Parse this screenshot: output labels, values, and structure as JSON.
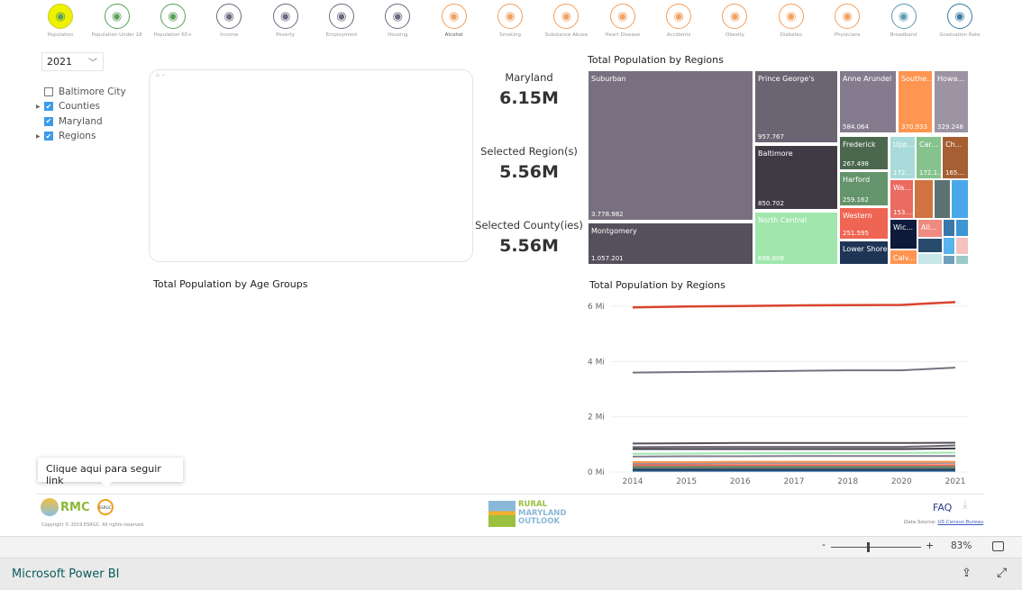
{
  "nav": [
    {
      "label": "Population",
      "icon": "family-icon",
      "color": "#5aa05a",
      "active": true
    },
    {
      "label": "Population Under 18",
      "icon": "children-icon",
      "color": "#5aa05a"
    },
    {
      "label": "Population 65+",
      "icon": "seniors-icon",
      "color": "#5aa05a"
    },
    {
      "label": "Income",
      "icon": "money-hand-icon",
      "color": "#6a6a80"
    },
    {
      "label": "Poverty",
      "icon": "money-bag-icon",
      "color": "#6a6a80"
    },
    {
      "label": "Employment",
      "icon": "briefcase-icon",
      "color": "#6a6a80"
    },
    {
      "label": "Housing",
      "icon": "house-icon",
      "color": "#6a6a80"
    },
    {
      "label": "Alcohol",
      "icon": "beer-icon",
      "color": "#f0a060"
    },
    {
      "label": "Smoking",
      "icon": "cigarette-icon",
      "color": "#f0a060"
    },
    {
      "label": "Substance Abuse",
      "icon": "pills-icon",
      "color": "#f0a060"
    },
    {
      "label": "Heart Disease",
      "icon": "heart-organ-icon",
      "color": "#f0a060"
    },
    {
      "label": "Accidents",
      "icon": "accident-icon",
      "color": "#f0a060"
    },
    {
      "label": "Obesity",
      "icon": "scale-icon",
      "color": "#f0a060"
    },
    {
      "label": "Diabetes",
      "icon": "heartbeat-icon",
      "color": "#f0a060"
    },
    {
      "label": "Physicians",
      "icon": "stethoscope-icon",
      "color": "#f0a060"
    },
    {
      "label": "Broadband",
      "icon": "antenna-icon",
      "color": "#5a9ab0"
    },
    {
      "label": "Graduation Rate",
      "icon": "graduate-icon",
      "color": "#3a7aa0"
    }
  ],
  "active_color": "#eef200",
  "year": "2021",
  "slicer": [
    {
      "label": "Baltimore City",
      "checked": false,
      "expandable": false
    },
    {
      "label": "Counties",
      "checked": true,
      "expandable": true
    },
    {
      "label": "Maryland",
      "checked": true,
      "expandable": false
    },
    {
      "label": "Regions",
      "checked": true,
      "expandable": true
    }
  ],
  "kpis": [
    {
      "label": "Maryland",
      "value": "6.15M"
    },
    {
      "label": "Selected Region(s)",
      "value": "5.56M"
    },
    {
      "label": "Selected County(ies)",
      "value": "5.56M"
    }
  ],
  "age_title": "Total Population by Age Groups",
  "treemap": {
    "title": "Total Population by Regions",
    "cells": [
      {
        "name": "Suburban",
        "value": "3.778.982",
        "color": "#787080"
      },
      {
        "name": "Montgomery",
        "value": "1.057.201",
        "color": "#564f5c"
      },
      {
        "name": "Prince George's",
        "value": "957.767",
        "color": "#6b6472"
      },
      {
        "name": "Baltimore",
        "value": "850.702",
        "color": "#3f3a44"
      },
      {
        "name": "North Central",
        "value": "698.808",
        "color": "#a0e6ad"
      },
      {
        "name": "Anne Arundel",
        "value": "584.064",
        "color": "#847c8e"
      },
      {
        "name": "Southe...",
        "value": "370.933",
        "color": "#fe9550"
      },
      {
        "name": "Howa...",
        "value": "329.248",
        "color": "#9c94a2"
      },
      {
        "name": "Frederick",
        "value": "267.498",
        "color": "#4b684f"
      },
      {
        "name": "Harford",
        "value": "259.162",
        "color": "#64946b"
      },
      {
        "name": "Western",
        "value": "251.595",
        "color": "#ef6553"
      },
      {
        "name": "Lower Shore",
        "value": "",
        "color": "#1f3556"
      },
      {
        "name": "Upp...",
        "value": "172....",
        "color": "#a8dbd9"
      },
      {
        "name": "Car...",
        "value": "172.1...",
        "color": "#86c28e"
      },
      {
        "name": "Ch...",
        "value": "165....",
        "color": "#a65f33"
      },
      {
        "name": "Wa...",
        "value": "153....",
        "color": "#ea6b5f"
      },
      {
        "name": "",
        "value": "",
        "color": "#cf7440"
      },
      {
        "name": "",
        "value": "",
        "color": "#5c7272"
      },
      {
        "name": "",
        "value": "",
        "color": "#4aa8ea"
      },
      {
        "name": "Wic...",
        "value": "",
        "color": "#0f1a3a"
      },
      {
        "name": "Calv...",
        "value": "",
        "color": "#fe9550"
      },
      {
        "name": "All...",
        "value": "",
        "color": "#ef8a80"
      },
      {
        "name": "",
        "value": "",
        "color": "#284b6c"
      },
      {
        "name": "",
        "value": "",
        "color": "#c7e7e8"
      },
      {
        "name": "",
        "value": "",
        "color": "#3a78ab"
      },
      {
        "name": "",
        "value": "",
        "color": "#3d95d4"
      },
      {
        "name": "",
        "value": "",
        "color": "#5ab4ec"
      },
      {
        "name": "",
        "value": "",
        "color": "#f6c2c0"
      },
      {
        "name": "",
        "value": "",
        "color": "#6f9fba"
      },
      {
        "name": "",
        "value": "",
        "color": "#9ccaca"
      }
    ]
  },
  "chart_data": {
    "type": "line",
    "title": "Total Population by Regions",
    "categories": [
      "2014",
      "2015",
      "2016",
      "2017",
      "2018",
      "2020",
      "2021"
    ],
    "yticks": [
      "0 Mi",
      "2 Mi",
      "4 Mi",
      "6 Mi"
    ],
    "ylim": [
      0,
      6.6
    ],
    "grid": true,
    "series": [
      {
        "color": "#d9442e",
        "values": [
          5.96,
          5.99,
          6.01,
          6.03,
          6.04,
          6.05,
          6.15
        ]
      },
      {
        "color": "#787080",
        "values": [
          3.6,
          3.62,
          3.64,
          3.66,
          3.68,
          3.68,
          3.78
        ]
      },
      {
        "color": "#564f5c",
        "values": [
          1.03,
          1.04,
          1.05,
          1.05,
          1.05,
          1.05,
          1.06
        ]
      },
      {
        "color": "#6b6472",
        "values": [
          0.9,
          0.91,
          0.91,
          0.91,
          0.91,
          0.91,
          0.96
        ]
      },
      {
        "color": "#3f3a44",
        "values": [
          0.83,
          0.83,
          0.83,
          0.83,
          0.83,
          0.83,
          0.85
        ]
      },
      {
        "color": "#a0e6ad",
        "values": [
          0.66,
          0.67,
          0.68,
          0.68,
          0.69,
          0.69,
          0.7
        ]
      },
      {
        "color": "#847c8e",
        "values": [
          0.56,
          0.57,
          0.57,
          0.58,
          0.58,
          0.58,
          0.58
        ]
      },
      {
        "color": "#fe9550",
        "values": [
          0.36,
          0.36,
          0.37,
          0.37,
          0.37,
          0.37,
          0.37
        ]
      },
      {
        "color": "#9c94a2",
        "values": [
          0.31,
          0.31,
          0.32,
          0.32,
          0.32,
          0.32,
          0.33
        ]
      },
      {
        "color": "#ef6553",
        "values": [
          0.25,
          0.25,
          0.25,
          0.25,
          0.25,
          0.25,
          0.25
        ]
      },
      {
        "color": "#64946b",
        "values": [
          0.2,
          0.2,
          0.2,
          0.2,
          0.2,
          0.2,
          0.2
        ]
      },
      {
        "color": "#5c7272",
        "values": [
          0.15,
          0.15,
          0.15,
          0.15,
          0.15,
          0.15,
          0.15
        ]
      },
      {
        "color": "#1f3556",
        "values": [
          0.08,
          0.08,
          0.08,
          0.08,
          0.08,
          0.08,
          0.08
        ]
      },
      {
        "color": "#3a78ab",
        "values": [
          0.04,
          0.04,
          0.04,
          0.04,
          0.04,
          0.04,
          0.04
        ]
      }
    ]
  },
  "tooltip": "Clique aqui para seguir link",
  "footer": {
    "rmc": "RMC",
    "esrgc": "ESRGC",
    "copyright": "Copyright © 2019 ESRGC. All rights reserved.",
    "logo": [
      "RURAL",
      "MARYLAND",
      "OUTLOOK"
    ],
    "faq": "FAQ",
    "source_label": "Data Source:",
    "source_link": "US Census Bureau"
  },
  "zoom": {
    "value": "83%",
    "minus": "-",
    "plus": "+",
    "level": 0.5
  },
  "powerbi": "Microsoft Power BI"
}
